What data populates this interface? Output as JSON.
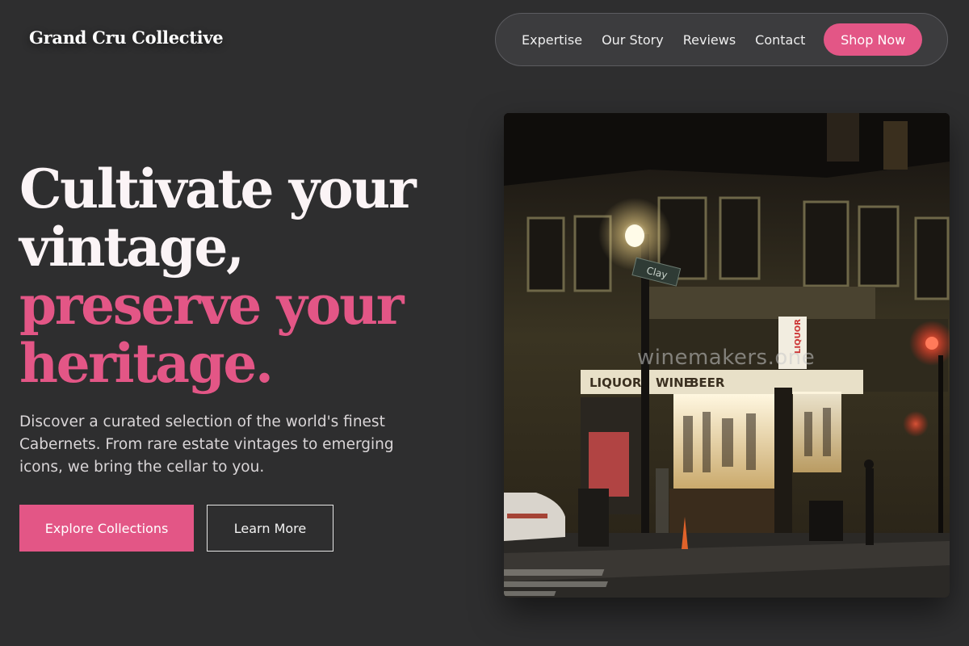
{
  "brand": {
    "name": "Grand Cru Collective"
  },
  "nav": {
    "links": [
      "Expertise",
      "Our Story",
      "Reviews",
      "Contact"
    ],
    "cta": "Shop Now"
  },
  "hero": {
    "headline_lines": [
      "Cultivate your",
      "vintage,"
    ],
    "headline_accent_lines": [
      "preserve your",
      "heritage."
    ],
    "description": "Discover a curated selection of the world's finest Cabernets. From rare estate vintages to emerging icons, we bring the cellar to you.",
    "primary_button": "Explore Collections",
    "secondary_button": "Learn More"
  },
  "image": {
    "watermark": "winemakers.one",
    "street_sign": "Clay",
    "shop_signs": [
      "LIQUORS",
      "WINE",
      "BEER",
      "LIQUOR"
    ]
  },
  "colors": {
    "background": "#2e2e2f",
    "accent": "#e35686",
    "nav_background": "#3c3c3e"
  }
}
